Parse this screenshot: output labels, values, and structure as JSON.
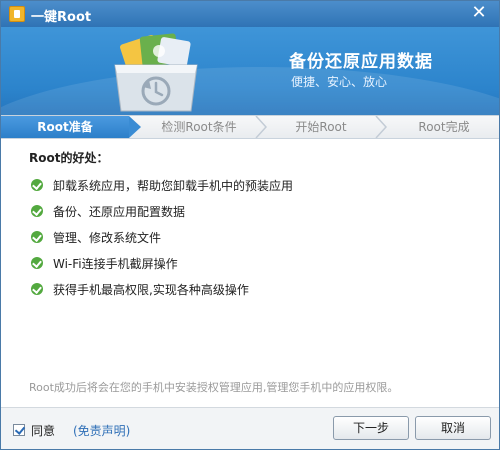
{
  "window": {
    "title": "一键Root",
    "close_symbol": "✕"
  },
  "banner": {
    "title": "备份还原应用数据",
    "subtitle": "便捷、安心、放心"
  },
  "steps": [
    {
      "label": "Root准备",
      "active": true
    },
    {
      "label": "检测Root条件",
      "active": false
    },
    {
      "label": "开始Root",
      "active": false
    },
    {
      "label": "Root完成",
      "active": false
    }
  ],
  "content": {
    "title": "Root的好处：",
    "items": [
      "卸载系统应用，帮助您卸载手机中的预装应用",
      "备份、还原应用配置数据",
      "管理、修改系统文件",
      "Wi-Fi连接手机截屏操作",
      "获得手机最高权限,实现各种高级操作"
    ],
    "notice": "Root成功后将会在您的手机中安装授权管理应用,管理您手机中的应用权限。"
  },
  "footer": {
    "agree_label": "同意",
    "agree_checked": true,
    "disclaimer_label": "(免责声明)",
    "next_label": "下一步",
    "cancel_label": "取消"
  },
  "icons": {
    "check": "check-circle-icon",
    "app": "root-app-icon",
    "hero": "backup-restore-icon"
  },
  "colors": {
    "titlebar": "#2f73b5",
    "accent": "#2c7fc9",
    "check": "#53a93f",
    "link": "#2f6fb7"
  }
}
